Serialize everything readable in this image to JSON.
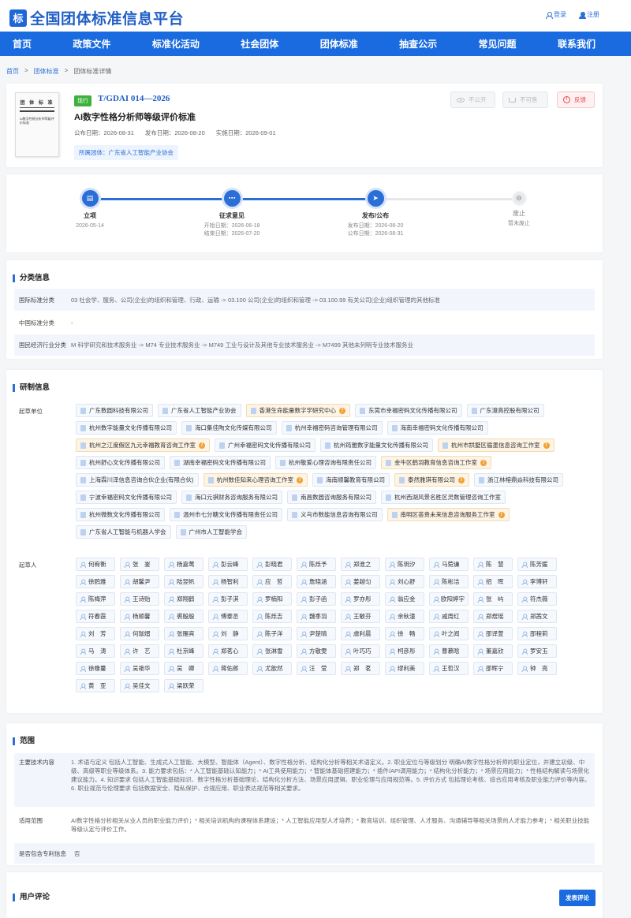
{
  "site": {
    "title": "全国团体标准信息平台",
    "login": "登录",
    "register": "注册"
  },
  "nav": [
    "首页",
    "政策文件",
    "标准化活动",
    "社会团体",
    "团体标准",
    "抽查公示",
    "常见问题",
    "联系我们"
  ],
  "breadcrumb": [
    "首页",
    "团体标准",
    "团体标准详情"
  ],
  "standard": {
    "status": "现行",
    "code": "T/GDAI 014—2026",
    "name": "AI数字性格分析师等级评价标准",
    "publish_date": "公布日期：2026-08-31",
    "release_date": "发布日期：2026-08-20",
    "implement_date": "实施日期：2026-09-01",
    "org": "所属团体：广东省人工智能产业协会",
    "thumb_title": "团 体 标 准",
    "thumb_text": "AI数字性格分析师等级评价标准"
  },
  "actions": {
    "private": "不公开",
    "not_sale": "不可售",
    "feedback": "反馈"
  },
  "timeline": {
    "progress": 0.67,
    "steps": [
      {
        "label": "立项",
        "lines": [
          "2026-05-14"
        ],
        "active": true
      },
      {
        "label": "征求意见",
        "lines": [
          "开始日期：2026-06-18",
          "结束日期：2026-07-20"
        ],
        "active": true
      },
      {
        "label": "发布/公布",
        "lines": [
          "发布日期：2026-08-20",
          "公布日期：2026-08-31"
        ],
        "active": true
      },
      {
        "label": "废止",
        "lines": [
          "暂未废止"
        ],
        "active": false
      }
    ]
  },
  "classify": {
    "title": "分类信息",
    "rows": [
      {
        "k": "国际标准分类",
        "v": "03 社会学、服务、公司(企业)的组织和管理、行政、运输 -> 03.100 公司(企业)的组织和管理 -> 03.100.99 有关公司(企业)组织管理的其他标准"
      },
      {
        "k": "中国标准分类",
        "v": "-"
      },
      {
        "k": "国民经济行业分类",
        "v": "M 科学研究和技术服务业 -> M74 专业技术服务业 -> M749 工业与设计及其他专业技术服务业 -> M7499 其他未列明专业技术服务业"
      }
    ]
  },
  "research": {
    "title": "研制信息",
    "units_label": "起草单位",
    "persons_label": "起草人",
    "units": [
      {
        "n": "广东数圆科技有限公司",
        "w": false
      },
      {
        "n": "广东省人工智能产业协会",
        "w": false
      },
      {
        "n": "香港生命能量数字学研究中心",
        "w": true
      },
      {
        "n": "东莞市幸福密码文化传播有限公司",
        "w": false
      },
      {
        "n": "广东澄高控股有限公司",
        "w": false
      },
      {
        "n": "杭州数字能量文化传播有限公司",
        "w": false
      },
      {
        "n": "海口集佳陶文化传媒有限公司",
        "w": false
      },
      {
        "n": "杭州幸福密码咨询管理有限公司",
        "w": false
      },
      {
        "n": "海南幸福密码文化传播有限公司",
        "w": false
      },
      {
        "n": "杭州之江度假区九元幸福教育咨询工作室",
        "w": true
      },
      {
        "n": "广州幸福密码文化传播有限公司",
        "w": false
      },
      {
        "n": "杭州筠雅数字能量文化传播有限公司",
        "w": false
      },
      {
        "n": "杭州市拱墅区循墨信息咨询工作室",
        "w": true
      },
      {
        "n": "杭州舒心文化传播有限公司",
        "w": false
      },
      {
        "n": "湖南幸福密码文化传播有限公司",
        "w": false
      },
      {
        "n": "杭州敬爱心理咨询有限责任公司",
        "w": false
      },
      {
        "n": "金牛区鹤羽教育信息咨询工作室",
        "w": true
      },
      {
        "n": "上海霖川泽信息咨询合伙企业(有限合伙)",
        "w": false
      },
      {
        "n": "杭州数佳知来心理咨询工作室",
        "w": true
      },
      {
        "n": "海南顺馨教育有限公司",
        "w": false
      },
      {
        "n": "泰然雅琪有限公司",
        "w": true
      },
      {
        "n": "浙江林榕鼎焱科技有限公司",
        "w": false
      },
      {
        "n": "宁波幸福密码文化传播有限公司",
        "w": false
      },
      {
        "n": "海口元祺财务咨询服务有限公司",
        "w": false
      },
      {
        "n": "南昌数圆咨询服务有限公司",
        "w": false
      },
      {
        "n": "杭州西湖风景名胜区灵数管理咨询工作室",
        "w": false
      },
      {
        "n": "杭州微数文化传播有限公司",
        "w": false
      },
      {
        "n": "温州市七分糖文化传播有限责任公司",
        "w": false
      },
      {
        "n": "义乌市数能信息咨询有限公司",
        "w": false
      },
      {
        "n": "南明区荟贵未来信息咨询服务工作室",
        "w": true
      },
      {
        "n": "广东省人工智能与机器人学会",
        "w": false
      },
      {
        "n": "广州市人工智能学会",
        "w": false
      }
    ],
    "persons": [
      "何宥衡",
      "张　崟",
      "杨嘉莺",
      "彭云峰",
      "彭晓君",
      "陈烁予",
      "郑淮之",
      "陈玥汐",
      "马菀谦",
      "陈　慧",
      "陈芳媛",
      "徐鸥雅",
      "胡馨尹",
      "陆翌帆",
      "杨智利",
      "应　哲",
      "詹晓涵",
      "姜越匀",
      "刘心舒",
      "陈彬洁",
      "招　晖",
      "李博轩",
      "陈梅萍",
      "王诗贻",
      "郑翔鹤",
      "彭子淇",
      "罗楠阳",
      "彭子函",
      "罗亦彤",
      "翁应金",
      "欧阳婷宇",
      "张　屿",
      "符杰薇",
      "符春霞",
      "杨顺馨",
      "裘殷殷",
      "傅泰丞",
      "陈烁吉",
      "魏季羽",
      "王敏芬",
      "余秋潼",
      "戚周红",
      "郑煜瑶",
      "郑茜文",
      "刘　芳",
      "何珈熠",
      "张雁宾",
      "刘　静",
      "陈子洋",
      "尹楚晴",
      "虞利晨",
      "徐　畅",
      "叶之闻",
      "邵译萱",
      "邵程莉",
      "马　涛",
      "许　艺",
      "杜京峰",
      "郑茗心",
      "张淋雪",
      "方敬雯",
      "叶巧巧",
      "柯彦彤",
      "曹慕晗",
      "董嘉欣",
      "罗安玉",
      "徐橡蔓",
      "吴艳华",
      "吴　卿",
      "蒋佑郎",
      "尤歆然",
      "汪　莹",
      "郑　茗",
      "缪利美",
      "王哲汉",
      "邵晖宁",
      "钟　亮",
      "黄　亚",
      "吴佳文",
      "梁跃荣"
    ]
  },
  "scope": {
    "title": "范围",
    "rows": [
      {
        "k": "主要技术内容",
        "v": "1. 术语与定义 包括人工智能、生成式人工智能、大模型、智能体（Agent）、数字性格分析、结构化分析等相关术语定义。2. 职业定位与等级划分 明确AI数字性格分析师的职业定位，并建立初级、中级、高级等职业等级体系。3. 能力要求包括：* 人工智能基础认知能力；* AI工具使用能力；* 智能体基础搭建能力；* 插件/API调用能力；* 结构化分析能力；* 场景应用能力；* 性格结构解读与场景化建议能力。4. 知识要求 包括人工智能基础知识、数字性格分析基础理论、结构化分析方法、场景应用逻辑、职业伦理与应用规范等。5. 评价方式 包括理论考核、综合应用考核及职业能力评价等内容。6. 职业规范与伦理要求 包括数据安全、隐私保护、合规应用、职业表达规范等相关要求。"
      },
      {
        "k": "适用范围",
        "v": "AI数字性格分析相关从业人员的职业能力评价；* 相关培训机构的课程体系建设；* 人工智能应用型人才培养；* 教育培训、组织管理、人才服务、沟通辅导等相关场景的人才能力参考；* 相关职业技能等级认定与评价工作。"
      },
      {
        "k": "是否包含专利信息",
        "v": "否"
      }
    ]
  },
  "comments": {
    "title": "用户评论",
    "button": "发表评论"
  }
}
